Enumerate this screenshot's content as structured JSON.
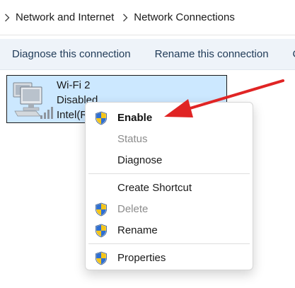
{
  "breadcrumb": {
    "items": [
      "Network and Internet",
      "Network Connections"
    ]
  },
  "toolbar": {
    "diagnose_label": "Diagnose this connection",
    "rename_label": "Rename this connection",
    "overflow_label": "C"
  },
  "adapter": {
    "name": "Wi-Fi 2",
    "status": "Disabled",
    "device": "Intel(R"
  },
  "context_menu": {
    "enable": "Enable",
    "status": "Status",
    "diagnose": "Diagnose",
    "create_shortcut": "Create Shortcut",
    "delete": "Delete",
    "rename": "Rename",
    "properties": "Properties"
  },
  "colors": {
    "selection": "#cce8ff",
    "command_bar": "#eef3f9",
    "annotation_arrow": "#e02424"
  },
  "icons": {
    "admin_shield": "uac-shield-icon",
    "adapter": "network-adapter-icon"
  }
}
